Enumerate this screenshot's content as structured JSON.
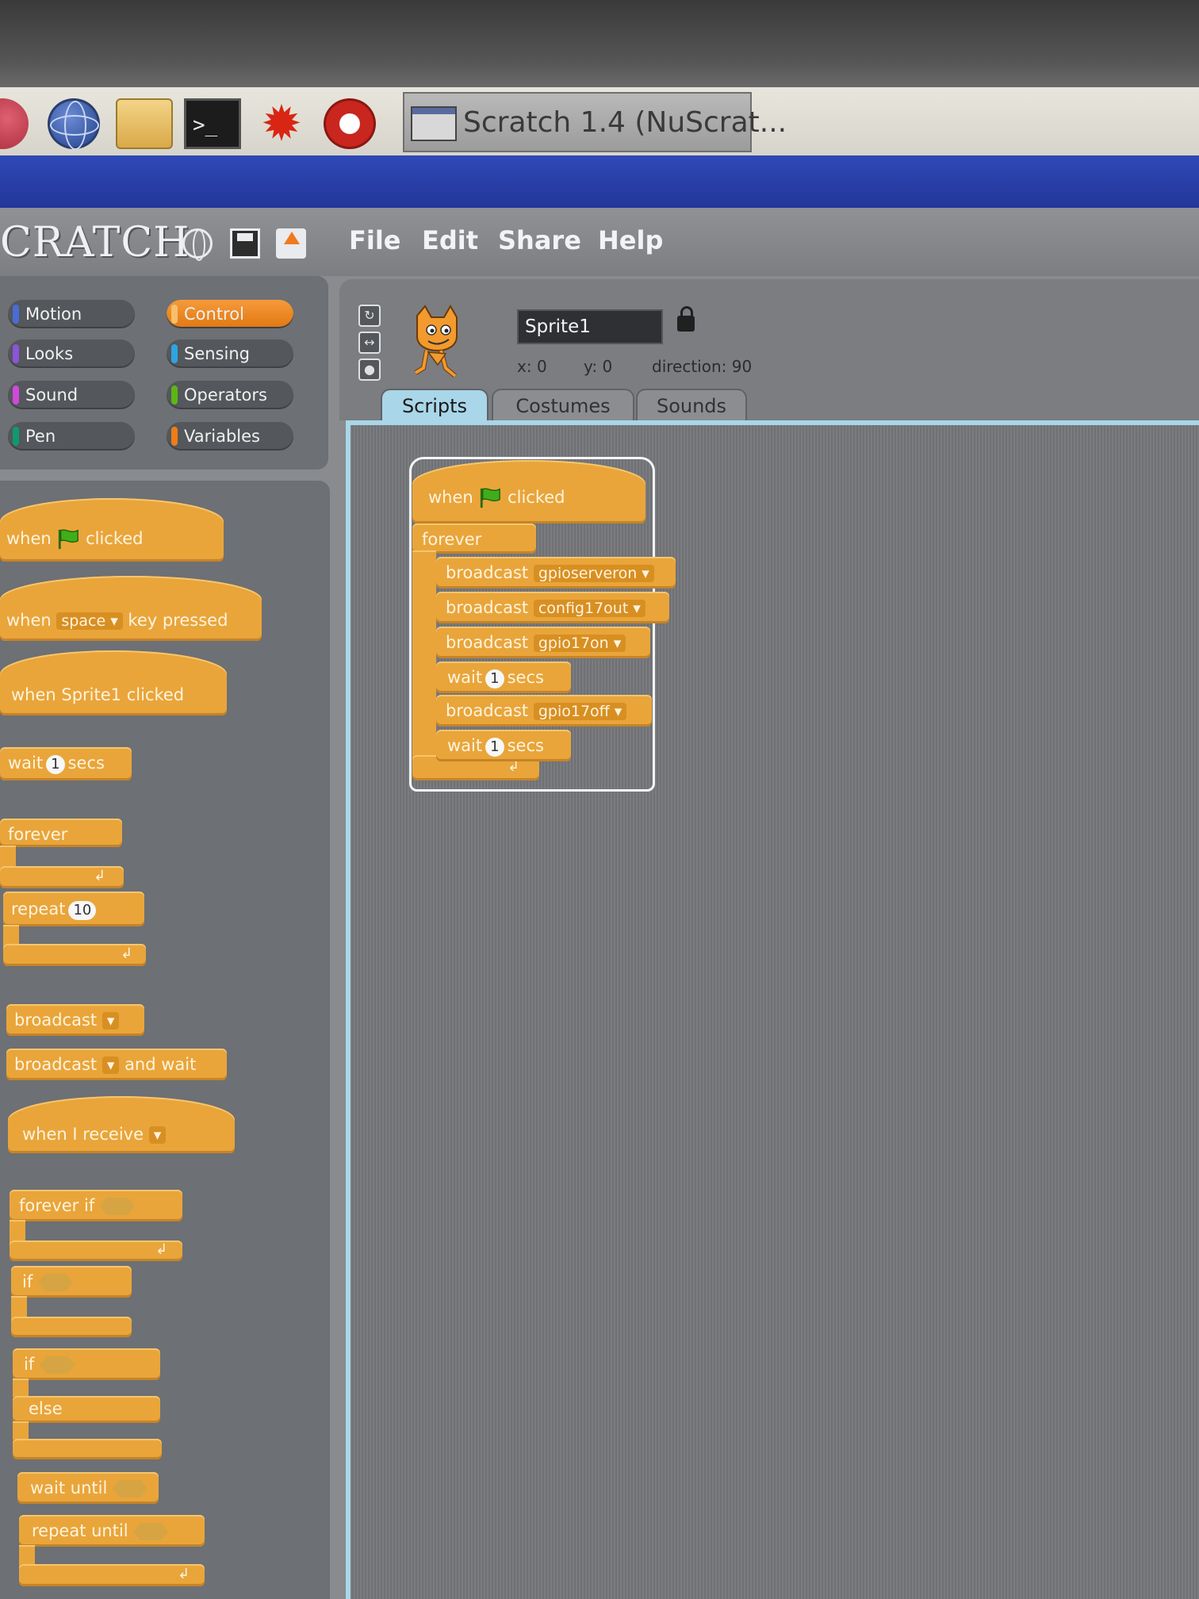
{
  "taskbar": {
    "window_title": "Scratch 1.4 (NuScrat...",
    "terminal_glyph": ">_",
    "burst_glyph": "✹"
  },
  "app": {
    "logo": "CRATCH",
    "menu": {
      "file": "File",
      "edit": "Edit",
      "share": "Share",
      "help": "Help"
    }
  },
  "categories": {
    "motion": "Motion",
    "looks": "Looks",
    "sound": "Sound",
    "pen": "Pen",
    "control": "Control",
    "sensing": "Sensing",
    "operators": "Operators",
    "variables": "Variables"
  },
  "sprite": {
    "name": "Sprite1",
    "x_label": "x:",
    "x": "0",
    "y_label": "y:",
    "y": "0",
    "direction_label": "direction:",
    "direction": "90"
  },
  "tabs": {
    "scripts": "Scripts",
    "costumes": "Costumes",
    "sounds": "Sounds"
  },
  "palette": {
    "when": "when",
    "clicked": "clicked",
    "key_when": "when",
    "key": "space",
    "key_pressed": "key pressed",
    "sprite_clicked": "when Sprite1 clicked",
    "wait": "wait",
    "wait_val": "1",
    "secs": "secs",
    "forever": "forever",
    "repeat": "repeat",
    "repeat_val": "10",
    "broadcast": "broadcast",
    "broadcast_wait": "broadcast",
    "and_wait": "and wait",
    "when_receive": "when I receive",
    "forever_if": "forever if",
    "if": "if",
    "if2": "if",
    "else": "else",
    "wait_until": "wait until",
    "repeat_until": "repeat until",
    "loop_arrow": "↲"
  },
  "script": {
    "when": "when",
    "clicked": "clicked",
    "forever": "forever",
    "b1": "broadcast",
    "m1": "gpioserveron",
    "b2": "broadcast",
    "m2": "config17out",
    "b3": "broadcast",
    "m3": "gpio17on",
    "w1": "wait",
    "w1v": "1",
    "w1s": "secs",
    "b4": "broadcast",
    "m4": "gpio17off",
    "w2": "wait",
    "w2v": "1",
    "w2s": "secs",
    "loop_arrow": "↲"
  },
  "colors": {
    "control_orange": "#e9a53a",
    "titlebar_blue": "#2f49b6",
    "scripts_tab": "#a9d6e8"
  }
}
